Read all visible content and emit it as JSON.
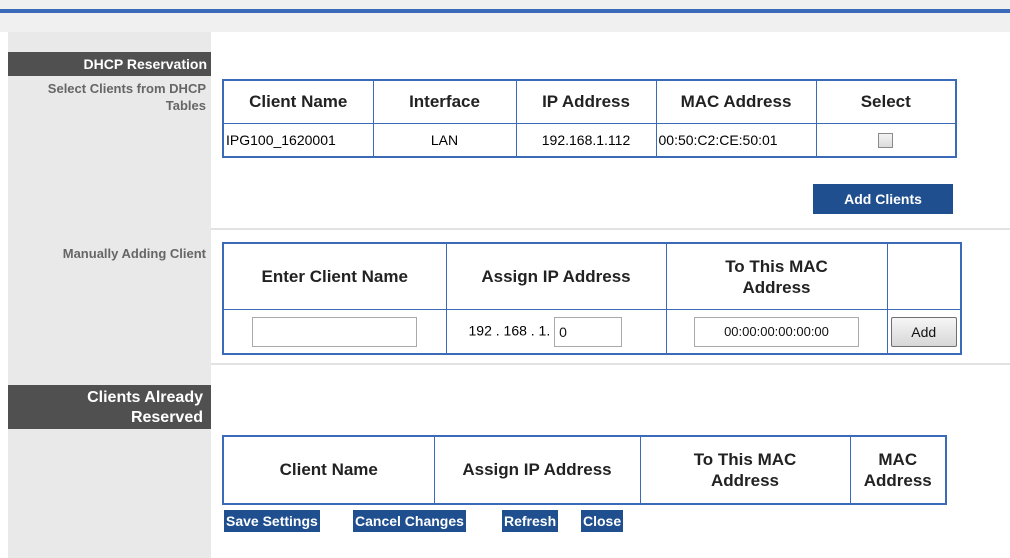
{
  "sidebar": {
    "dhcp_reservation": "DHCP Reservation",
    "select_clients_note": "Select Clients from DHCP Tables",
    "manually_adding": "Manually Adding Client",
    "clients_reserved": "Clients Already Reserved"
  },
  "dhcp_table": {
    "headers": [
      "Client Name",
      "Interface",
      "IP Address",
      "MAC Address",
      "Select"
    ],
    "row": {
      "client_name": "IPG100_1620001",
      "interface": "LAN",
      "ip_address": "192.168.1.112",
      "mac_address": "00:50:C2:CE:50:01",
      "selected": false
    }
  },
  "add_clients_label": "Add Clients",
  "manual_table": {
    "headers": [
      "Enter Client Name",
      "Assign IP Address",
      "To This MAC Address",
      ""
    ],
    "client_name_value": "",
    "ip_prefix": "192 . 168 . 1.",
    "ip_last_octet": "0",
    "mac_value": "00:00:00:00:00:00",
    "add_label": "Add"
  },
  "reserved_table": {
    "headers": [
      "Client Name",
      "Assign IP Address",
      "To This MAC Address",
      "MAC Address"
    ]
  },
  "footer_buttons": {
    "save": "Save Settings",
    "cancel": "Cancel Changes",
    "refresh": "Refresh",
    "close": "Close"
  },
  "colors": {
    "accent_blue": "#3a6ab8",
    "button_blue": "#1f4f8e",
    "sidebar_gray": "#e9e9e9",
    "header_dark": "#505050"
  }
}
